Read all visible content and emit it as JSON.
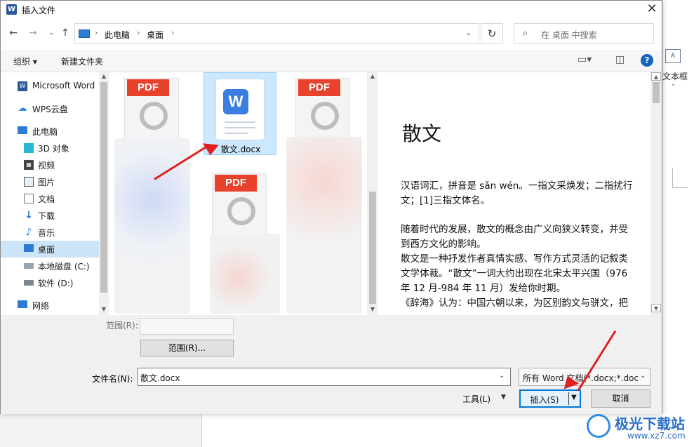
{
  "window": {
    "title": "插入文件",
    "app_icon": "W"
  },
  "nav": {
    "breadcrumbs": [
      "此电脑",
      "桌面"
    ],
    "search_placeholder": "在 桌面 中搜索"
  },
  "toolbar": {
    "organize": "组织 ▾",
    "new_folder": "新建文件夹"
  },
  "sidebar": {
    "items": [
      {
        "label": "Microsoft Word",
        "icon": "word-icon"
      },
      {
        "label": "WPS云盘",
        "icon": "cloud-icon"
      },
      {
        "label": "此电脑",
        "icon": "pc-icon"
      },
      {
        "label": "3D 对象",
        "icon": "3d-objects-icon"
      },
      {
        "label": "视频",
        "icon": "video-icon"
      },
      {
        "label": "图片",
        "icon": "picture-icon"
      },
      {
        "label": "文档",
        "icon": "document-icon"
      },
      {
        "label": "下载",
        "icon": "download-icon"
      },
      {
        "label": "音乐",
        "icon": "music-icon"
      },
      {
        "label": "桌面",
        "icon": "desktop-icon"
      },
      {
        "label": "本地磁盘 (C:)",
        "icon": "drive-icon"
      },
      {
        "label": "软件 (D:)",
        "icon": "drive-icon"
      },
      {
        "label": "网络",
        "icon": "network-icon"
      }
    ],
    "selected_index": 9
  },
  "files": {
    "pdf_badge": "PDF",
    "word_badge": "W",
    "selected_file": "散文.docx"
  },
  "preview": {
    "title": "散文",
    "paragraphs": [
      "汉语词汇，拼音是 sǎn wén。一指文采焕发；二指扰行文；[1]三指文体名。",
      "随着时代的发展，散文的概念由广义向狭义转变，并受到西方文化的影响。",
      "散文是一种抒发作者真情实感、写作方式灵活的记叙类文学体裁。“散文”一词大约出现在北宋太平兴国（976 年 12 月-984 年 11 月）发给你时期。",
      "《辞海》认为：中国六朝以来，为区别韵文与骈文，把"
    ]
  },
  "bottom": {
    "range_label": "范围(R):",
    "range_button": "范围(R)...",
    "filename_label": "文件名(N):",
    "filename_value": "散文.docx",
    "filter_value": "所有 Word 文档(*.docx;*.docx",
    "tools_label": "工具(L)",
    "insert_label": "插入(S)",
    "cancel_label": "取消"
  },
  "background": {
    "textbox_label": "文本框",
    "textbox_icon": "A"
  },
  "watermark": {
    "brand": "极光下载站",
    "url": "www.xz7.com"
  },
  "colors": {
    "accent": "#0078d7",
    "selection": "#cce8ff",
    "pdf_red": "#e8412c",
    "word_blue": "#3b7de0",
    "arrow_red": "#e02020"
  }
}
